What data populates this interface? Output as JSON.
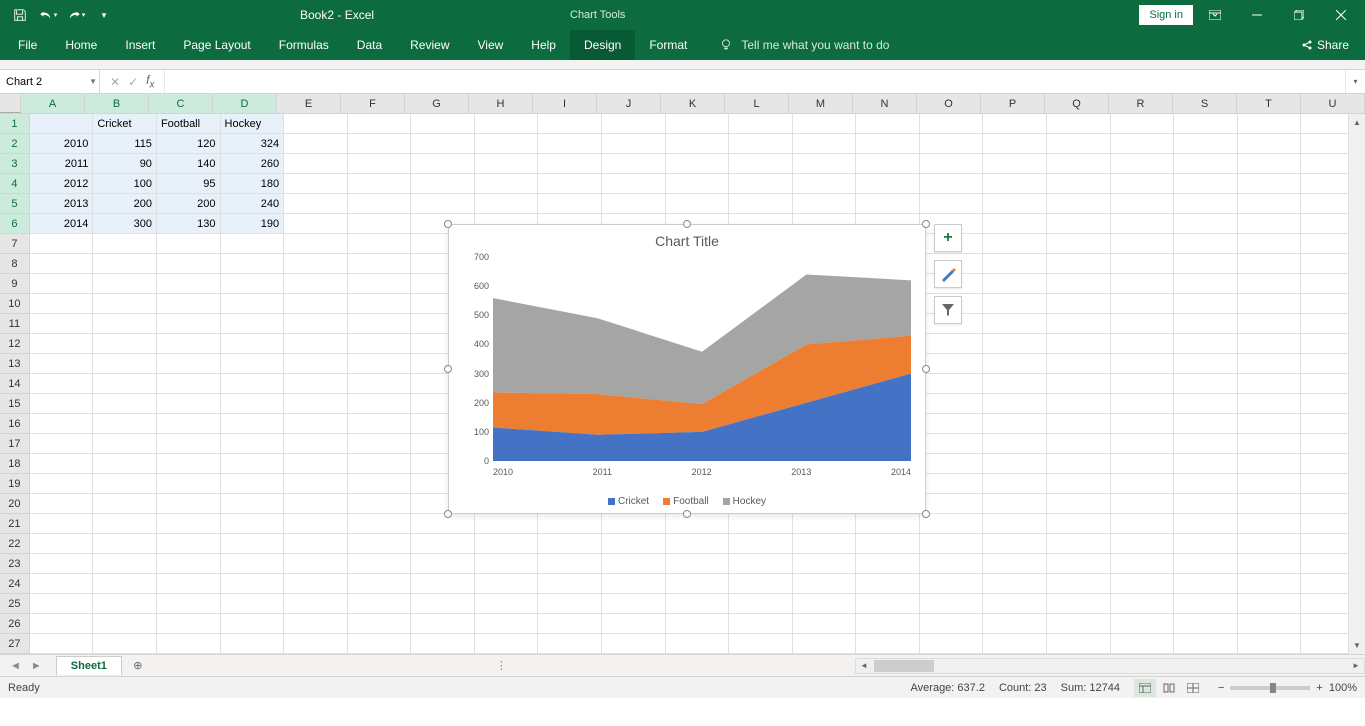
{
  "app": {
    "doc_title": "Book2 - Excel",
    "chart_tools": "Chart Tools",
    "signin": "Sign in"
  },
  "tabs": {
    "file": "File",
    "home": "Home",
    "insert": "Insert",
    "page_layout": "Page Layout",
    "formulas": "Formulas",
    "data": "Data",
    "review": "Review",
    "view": "View",
    "help": "Help",
    "design": "Design",
    "format": "Format",
    "tellme": "Tell me what you want to do",
    "share": "Share"
  },
  "formula": {
    "namebox": "Chart 2",
    "value": ""
  },
  "grid": {
    "cols": [
      "A",
      "B",
      "C",
      "D",
      "E",
      "F",
      "G",
      "H",
      "I",
      "J",
      "K",
      "L",
      "M",
      "N",
      "O",
      "P",
      "Q",
      "R",
      "S",
      "T",
      "U"
    ],
    "headers": {
      "B": "Cricket",
      "C": "Football",
      "D": "Hockey"
    },
    "rows": [
      {
        "n": "1"
      },
      {
        "n": "2"
      },
      {
        "n": "3"
      },
      {
        "n": "4"
      },
      {
        "n": "5"
      },
      {
        "n": "6"
      },
      {
        "n": "7"
      },
      {
        "n": "8"
      },
      {
        "n": "9"
      },
      {
        "n": "10"
      },
      {
        "n": "11"
      },
      {
        "n": "12"
      },
      {
        "n": "13"
      },
      {
        "n": "14"
      },
      {
        "n": "15"
      },
      {
        "n": "16"
      },
      {
        "n": "17"
      },
      {
        "n": "18"
      },
      {
        "n": "19"
      },
      {
        "n": "20"
      },
      {
        "n": "21"
      },
      {
        "n": "22"
      },
      {
        "n": "23"
      },
      {
        "n": "24"
      },
      {
        "n": "25"
      },
      {
        "n": "26"
      },
      {
        "n": "27"
      }
    ],
    "data": [
      [
        "2010",
        "115",
        "120",
        "324"
      ],
      [
        "2011",
        "90",
        "140",
        "260"
      ],
      [
        "2012",
        "100",
        "95",
        "180"
      ],
      [
        "2013",
        "200",
        "200",
        "240"
      ],
      [
        "2014",
        "300",
        "130",
        "190"
      ]
    ]
  },
  "chart_data": {
    "type": "area",
    "title": "Chart Title",
    "categories": [
      "2010",
      "2011",
      "2012",
      "2013",
      "2014"
    ],
    "series": [
      {
        "name": "Cricket",
        "values": [
          115,
          90,
          100,
          200,
          300
        ],
        "color": "#4472c4"
      },
      {
        "name": "Football",
        "values": [
          120,
          140,
          95,
          200,
          130
        ],
        "color": "#ed7d31"
      },
      {
        "name": "Hockey",
        "values": [
          324,
          260,
          180,
          240,
          190
        ],
        "color": "#a5a5a5"
      }
    ],
    "ylim": [
      0,
      700
    ],
    "yticks": [
      0,
      100,
      200,
      300,
      400,
      500,
      600,
      700
    ],
    "stacked": true
  },
  "sheets": {
    "active": "Sheet1"
  },
  "status": {
    "ready": "Ready",
    "avg": "Average: 637.2",
    "count": "Count: 23",
    "sum": "Sum: 12744",
    "zoom": "100%"
  }
}
